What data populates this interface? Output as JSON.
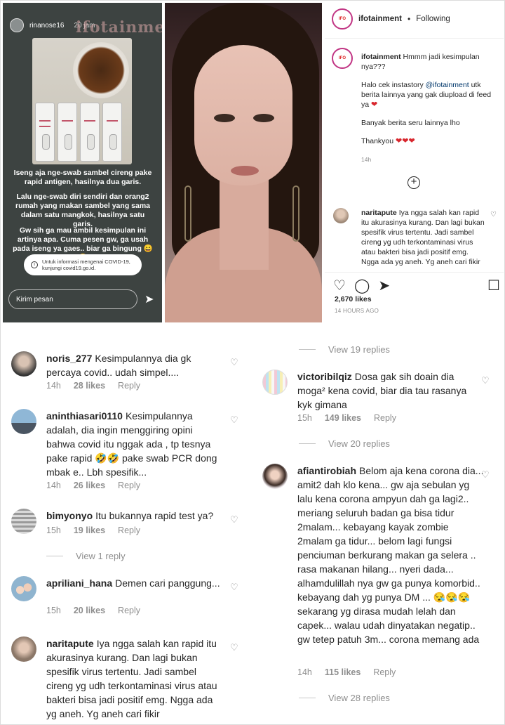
{
  "story": {
    "username": "rinanose16",
    "time": "20 jam",
    "watermark": "ifotainment",
    "text1": "Iseng aja nge-swab sambel cireng pake rapid antigen, hasilnya dua garis.",
    "text2": "Lalu nge-swab diri sendiri dan orang2 rumah yang makan sambel yang sama dalam satu mangkok, hasilnya satu garis.",
    "text3": "Gw sih ga mau ambil kesimpulan ini artinya apa. Cuma pesen gw, ga usah pada iseng ya gaes.. biar ga bingung 😄😄",
    "info": "Untuk informasi mengenai COVID-19, kunjungi covid19.go.id.",
    "message_placeholder": "Kirim pesan"
  },
  "panel": {
    "header": {
      "username": "ifotainment",
      "follow": "Following",
      "dot": "•"
    },
    "caption": {
      "username": "ifotainment",
      "line1": "Hmmm jadi kesimpulan nya???",
      "line2a": "Halo cek instastory",
      "mention": "@ifotainment",
      "line2b": "utk berita lainnya yang gak diupload di feed ya",
      "line3": "Banyak berita seru lainnya lho",
      "line4": "Thankyou",
      "time": "14h"
    },
    "comment": {
      "username": "naritapute",
      "text": "Iya ngga salah kan rapid itu akurasinya kurang. Dan lagi bukan spesifik virus tertentu. Jadi sambel cireng yg udh terkontaminasi virus atau bakteri bisa jadi positif emg. Ngga ada yg aneh. Yg aneh cari fikir"
    },
    "likes": "2,670 likes",
    "timestamp": "14 HOURS AGO"
  },
  "left_comments": [
    {
      "username": "noris_277",
      "text": "Kesimpulannya dia gk percaya covid.. udah simpel....",
      "time": "14h",
      "likes": "28 likes",
      "reply": "Reply"
    },
    {
      "username": "aninthiasari0110",
      "text": "Kesimpulannya adalah, dia ingin menggiring opini bahwa covid itu nggak ada , tp tesnya pake rapid 🤣🤣 pake swab PCR dong mbak e.. Lbh spesifik...",
      "time": "14h",
      "likes": "26 likes",
      "reply": "Reply"
    },
    {
      "username": "bimyonyo",
      "text": "Itu bukannya rapid test ya?",
      "time": "15h",
      "likes": "19 likes",
      "reply": "Reply"
    },
    {
      "username": "apriliani_hana",
      "text": "Demen cari panggung...",
      "time": "15h",
      "likes": "20 likes",
      "reply": "Reply"
    },
    {
      "username": "naritapute",
      "text": "Iya ngga salah kan rapid itu akurasinya kurang. Dan lagi bukan spesifik virus tertentu. Jadi sambel cireng yg udh terkontaminasi virus atau bakteri bisa jadi positif emg. Ngga ada yg aneh. Yg aneh cari fikir",
      "time": "",
      "likes": "",
      "reply": ""
    }
  ],
  "left_view_replies": "View 1 reply",
  "right_comments": [
    {
      "username": "victoribilqiz",
      "text": "Dosa gak sih doain dia moga² kena covid, biar dia tau rasanya kyk gimana",
      "time": "15h",
      "likes": "149 likes",
      "reply": "Reply"
    },
    {
      "username": "afiantirobiah",
      "text": "Belom aja kena corona dia... amit2 dah klo kena... gw aja sebulan yg lalu kena corona ampyun dah ga lagi2.. meriang seluruh badan ga bisa tidur 2malam... kebayang kayak zombie 2malam ga tidur... belom lagi fungsi penciuman berkurang makan ga selera .. rasa makanan hilang... nyeri dada... alhamdulillah nya gw ga punya komorbid.. kebayang dah yg punya DM ... 😪😪😪 sekarang yg dirasa mudah lelah dan capek... walau udah dinyatakan negatip.. gw tetep patuh 3m... corona memang ada",
      "time": "14h",
      "likes": "115 likes",
      "reply": "Reply"
    }
  ],
  "right_view_replies": [
    "View 19 replies",
    "View 20 replies",
    "View 28 replies"
  ]
}
